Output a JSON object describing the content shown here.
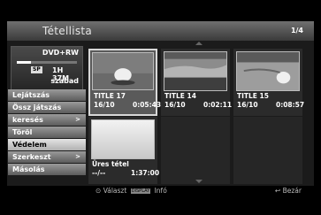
{
  "header": {
    "title": "Tétellista",
    "page": "1/4"
  },
  "disc": {
    "type": "DVD+RW",
    "mode": "SP",
    "remaining": "1H 37M",
    "free_label": "szabad",
    "used_fraction": 0.23
  },
  "menu": [
    {
      "label": "Lejátszás",
      "arrow": ""
    },
    {
      "label": "Össz játszás",
      "arrow": ""
    },
    {
      "label": "keresés",
      "arrow": ">"
    },
    {
      "label": "Töröl",
      "arrow": ""
    },
    {
      "label": "Védelem",
      "arrow": ""
    },
    {
      "label": "Szerkeszt",
      "arrow": ">"
    },
    {
      "label": "Másolás",
      "arrow": ""
    }
  ],
  "titles": [
    {
      "name": "TITLE 17",
      "date": "16/10",
      "duration": "0:05:43"
    },
    {
      "name": "TITLE 14",
      "date": "16/10",
      "duration": "0:02:11"
    },
    {
      "name": "TITLE 15",
      "date": "16/10",
      "duration": "0:08:57"
    },
    {
      "name": "Üres tétel",
      "date": "--/--",
      "duration": "1:37:00"
    }
  ],
  "help": {
    "select": "Választ",
    "display_badge": "DISPLAY",
    "info": "Infó",
    "close": "Bezár"
  }
}
